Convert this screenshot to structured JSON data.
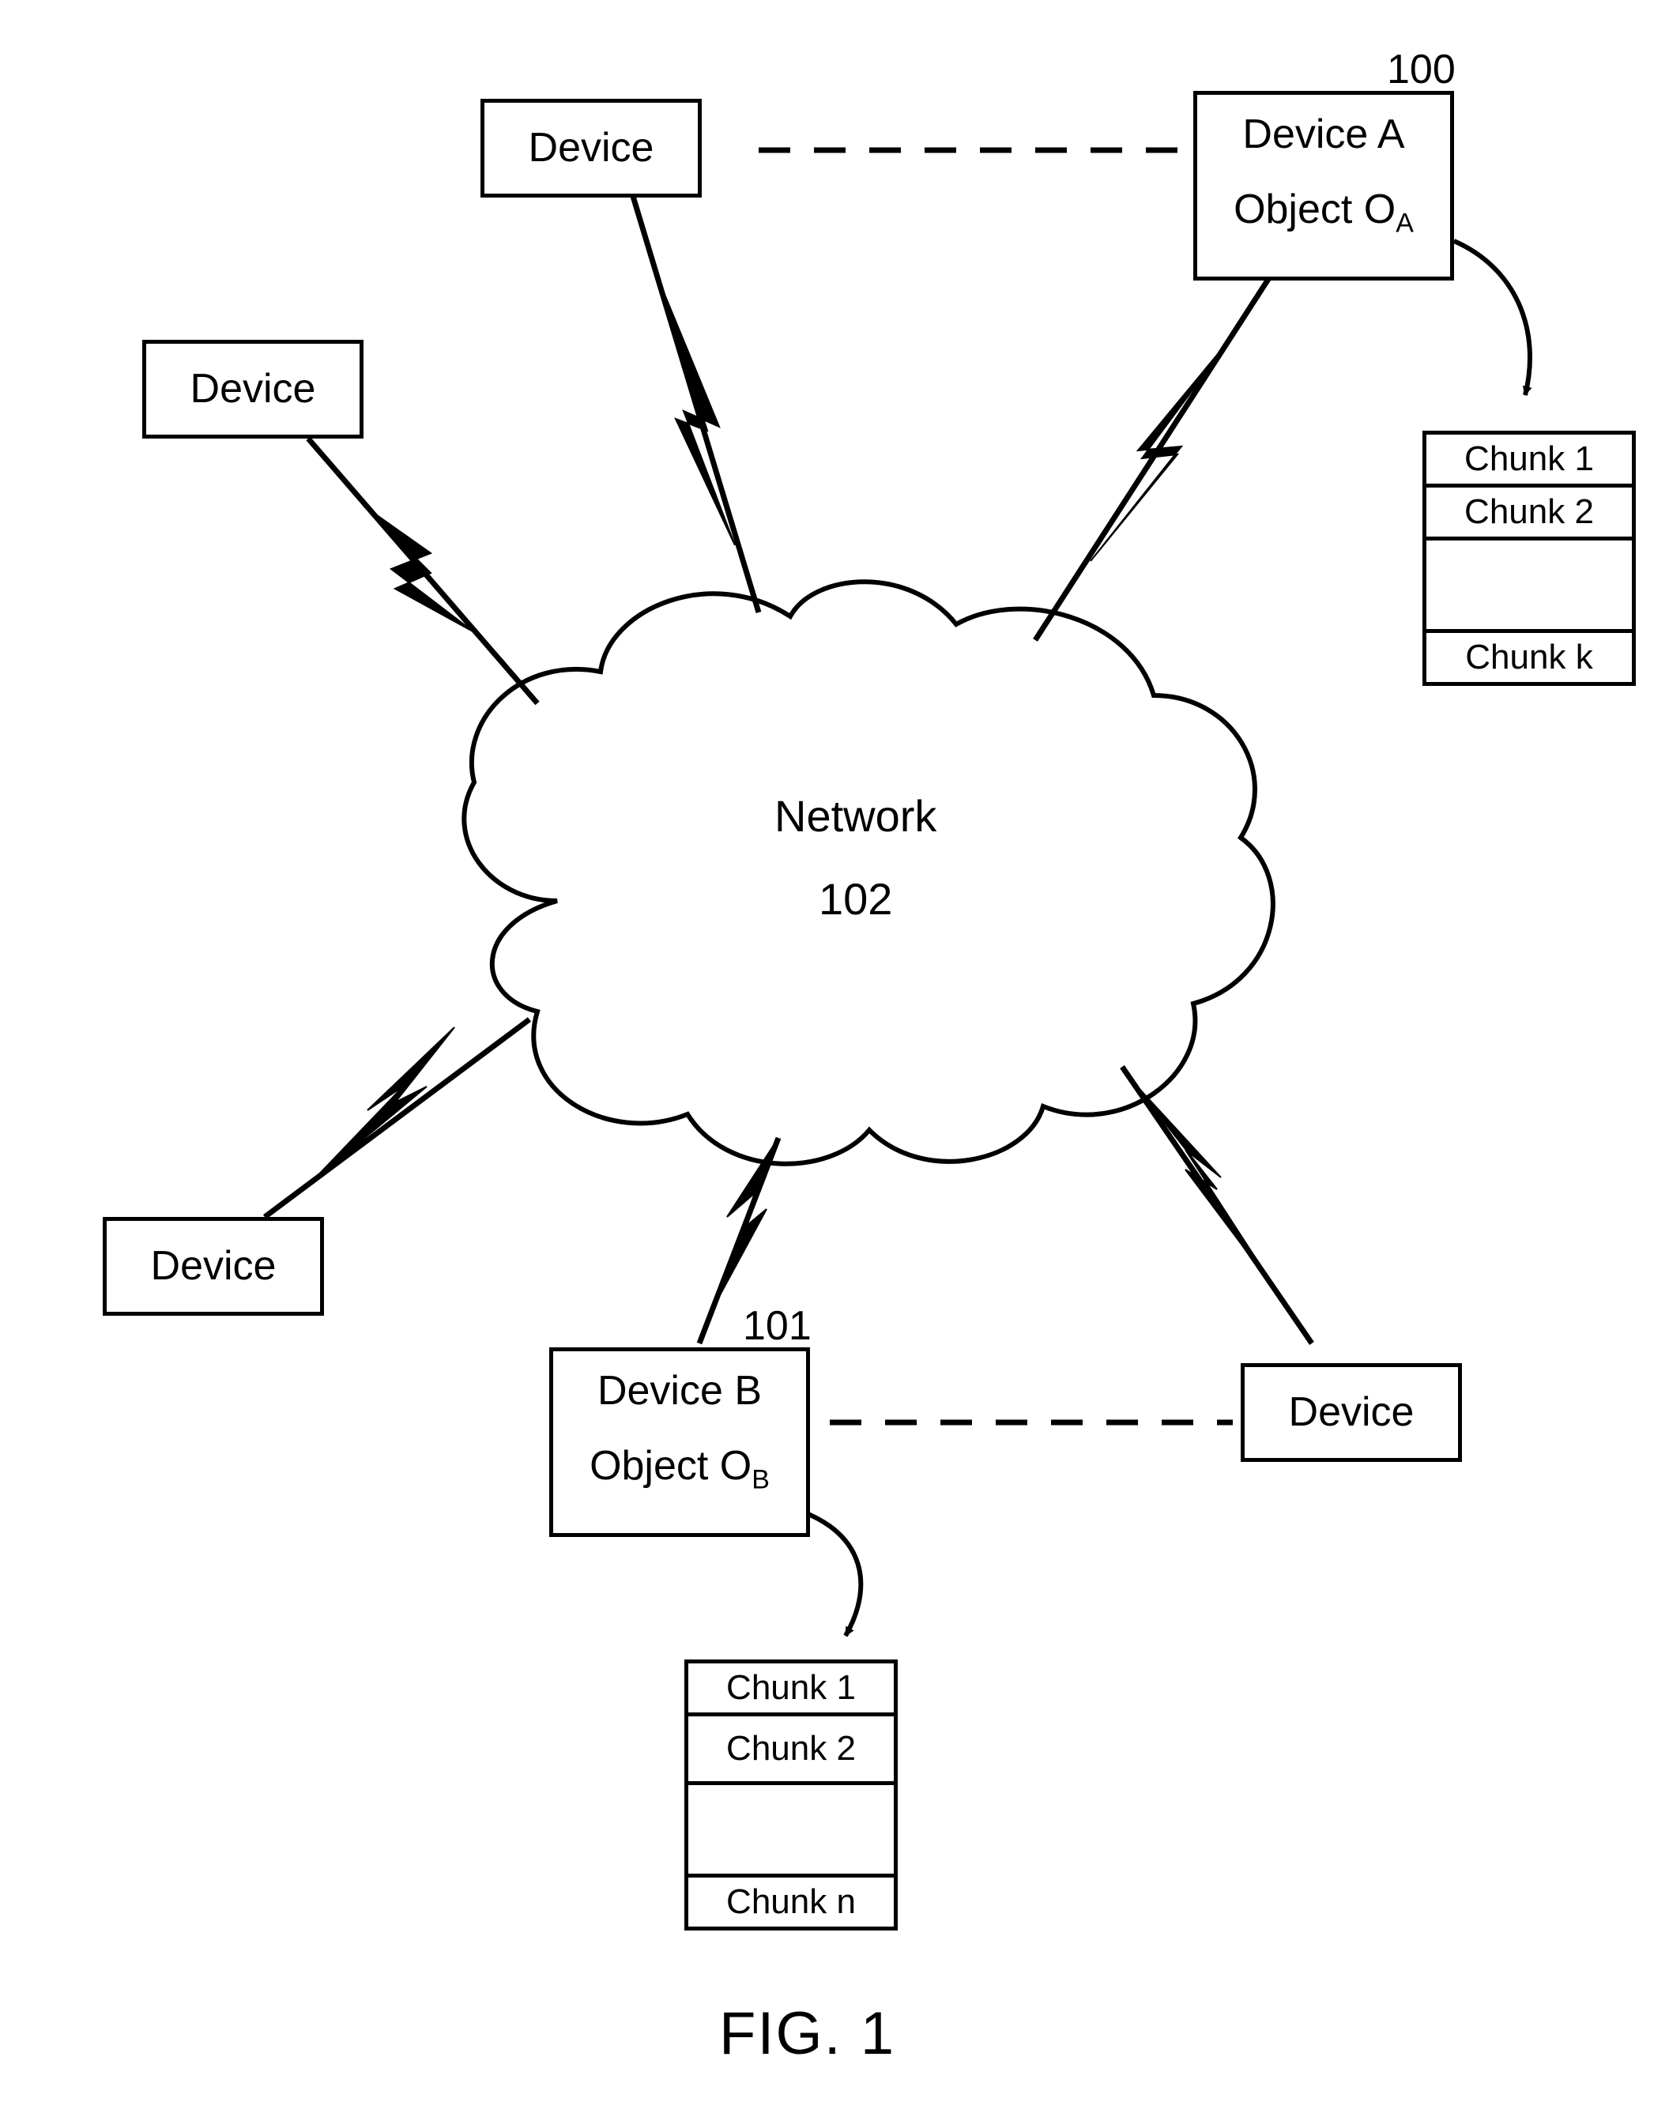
{
  "figure_caption": "FIG. 1",
  "network": {
    "label": "Network",
    "ref": "102"
  },
  "device_a": {
    "title": "Device A",
    "object": "Object O",
    "object_sub": "A",
    "ref": "100"
  },
  "device_b": {
    "title": "Device B",
    "object": "Object O",
    "object_sub": "B",
    "ref": "101"
  },
  "plain_device_label": "Device",
  "chunks_a": {
    "c1": "Chunk 1",
    "c2": "Chunk 2",
    "ck": "Chunk k"
  },
  "chunks_b": {
    "c1": "Chunk 1",
    "c2": "Chunk 2",
    "cn": "Chunk n"
  }
}
